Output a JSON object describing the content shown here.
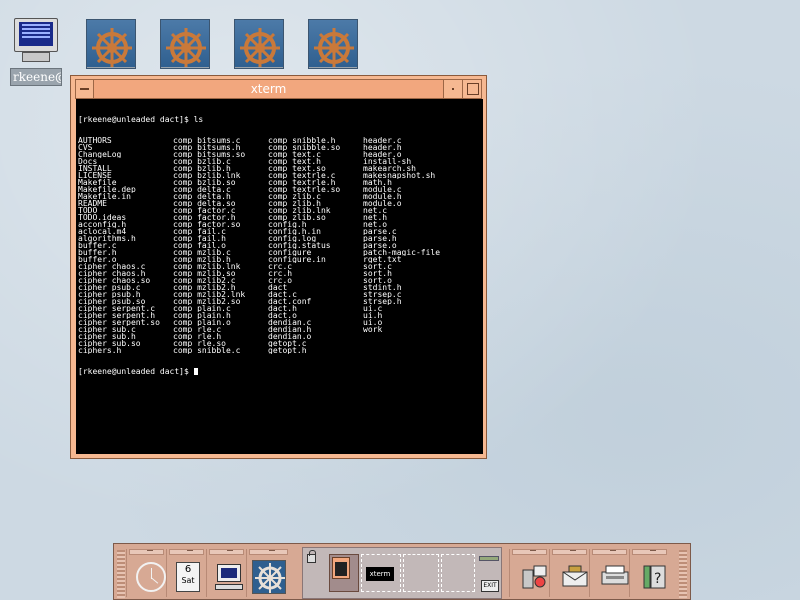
{
  "desktop": {
    "host_label": "rkeene@",
    "wheel_tiles": 4
  },
  "xterm": {
    "title": "xterm",
    "command_line": "[rkeene@unleaded dact]$ ls",
    "prompt_line": "[rkeene@unleaded dact]$ ",
    "listing_rows": [
      [
        "AUTHORS",
        "comp_bitsums.c",
        "comp_snibble.h",
        "header.c"
      ],
      [
        "CVS",
        "comp_bitsums.h",
        "comp_snibble.so",
        "header.h"
      ],
      [
        "ChangeLog",
        "comp_bitsums.so",
        "comp_text.c",
        "header.o"
      ],
      [
        "Docs",
        "comp_bzlib.c",
        "comp_text.h",
        "install-sh"
      ],
      [
        "INSTALL",
        "comp_bzlib.h",
        "comp_text.so",
        "makearch.sh"
      ],
      [
        "LICENSE",
        "comp_bzlib.lnk",
        "comp_textrle.c",
        "makesnapshot.sh"
      ],
      [
        "Makefile",
        "comp_bzlib.so",
        "comp_textrle.h",
        "math.h"
      ],
      [
        "Makefile.dep",
        "comp_delta.c",
        "comp_textrle.so",
        "module.c"
      ],
      [
        "Makefile.in",
        "comp_delta.h",
        "comp_zlib.c",
        "module.h"
      ],
      [
        "README",
        "comp_delta.so",
        "comp_zlib.h",
        "module.o"
      ],
      [
        "TODO",
        "comp_factor.c",
        "comp_zlib.lnk",
        "net.c"
      ],
      [
        "TODO.ideas",
        "comp_factor.h",
        "comp_zlib.so",
        "net.h"
      ],
      [
        "acconfig.h",
        "comp_factor.so",
        "config.h",
        "net.o"
      ],
      [
        "aclocal.m4",
        "comp_fail.c",
        "config.h.in",
        "parse.c"
      ],
      [
        "algorithms.h",
        "comp_fail.h",
        "config.log",
        "parse.h"
      ],
      [
        "buffer.c",
        "comp_fail.o",
        "config.status",
        "parse.o"
      ],
      [
        "buffer.h",
        "comp_mzlib.c",
        "configure",
        "patch-magic-file"
      ],
      [
        "buffer.o",
        "comp_mzlib.h",
        "configure.in",
        "rget.txt"
      ],
      [
        "cipher_chaos.c",
        "comp_mzlib.lnk",
        "crc.c",
        "sort.c"
      ],
      [
        "cipher_chaos.h",
        "comp_mzlib.so",
        "crc.h",
        "sort.h"
      ],
      [
        "cipher_chaos.so",
        "comp_mzlib2.c",
        "crc.o",
        "sort.o"
      ],
      [
        "cipher_psub.c",
        "comp_mzlib2.h",
        "dact",
        "stdint.h"
      ],
      [
        "cipher_psub.h",
        "comp_mzlib2.lnk",
        "dact.c",
        "strsep.c"
      ],
      [
        "cipher_psub.so",
        "comp_mzlib2.so",
        "dact.conf",
        "strsep.h"
      ],
      [
        "cipher_serpent.c",
        "comp_plain.c",
        "dact.h",
        "ui.c"
      ],
      [
        "cipher_serpent.h",
        "comp_plain.h",
        "dact.o",
        "ui.h"
      ],
      [
        "cipher_serpent.so",
        "comp_plain.o",
        "dendian.c",
        "ui.o"
      ],
      [
        "cipher_sub.c",
        "comp_rle.c",
        "dendian.h",
        "work"
      ],
      [
        "cipher_sub.h",
        "comp_rle.h",
        "dendian.o",
        ""
      ],
      [
        "cipher_sub.so",
        "comp_rle.so",
        "getopt.c",
        ""
      ],
      [
        "ciphers.h",
        "comp_snibble.c",
        "getopt.h",
        ""
      ]
    ]
  },
  "panel": {
    "calendar_day": "6",
    "calendar_weekday": "Sat",
    "workspace_window_label": "xterm",
    "exit_label": "EXIT"
  },
  "colors": {
    "window_frame": "#f6b891",
    "terminal_bg": "#000000",
    "terminal_fg": "#ffffff",
    "panel": "#d7a994",
    "desktop": "#cdd9e3"
  }
}
